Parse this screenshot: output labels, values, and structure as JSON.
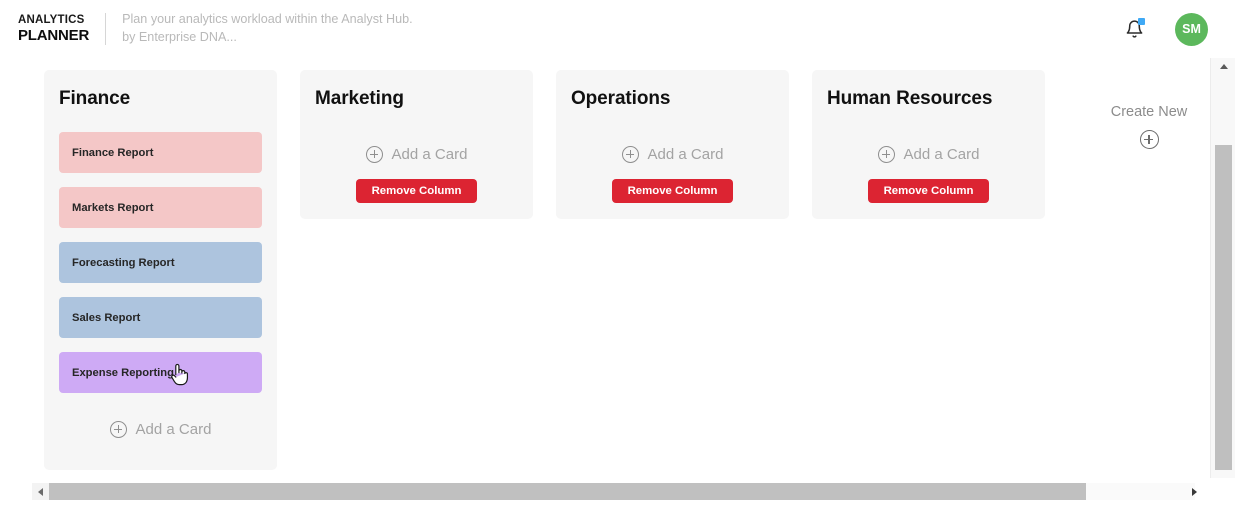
{
  "header": {
    "logo_line1": "ANALYTICS",
    "logo_line2": "PLANNER",
    "tagline_line1": "Plan your analytics workload within the Analyst Hub.",
    "tagline_line2": "by Enterprise DNA...",
    "bell_icon": "bell-icon",
    "notification_badge_color": "#3fa9f5",
    "avatar_initials": "SM",
    "avatar_color": "#5cb85c"
  },
  "board": {
    "add_card_label": "Add a Card",
    "remove_column_label": "Remove Column",
    "columns": [
      {
        "title": "Finance",
        "has_remove_button": false,
        "cards": [
          {
            "label": "Finance Report",
            "color": "#f4c7c7"
          },
          {
            "label": "Markets Report",
            "color": "#f4c7c7"
          },
          {
            "label": "Forecasting Report",
            "color": "#adc4de"
          },
          {
            "label": "Sales Report",
            "color": "#adc4de"
          },
          {
            "label": "Expense Reporting",
            "color": "#ceaaf5"
          }
        ]
      },
      {
        "title": "Marketing",
        "has_remove_button": true,
        "cards": []
      },
      {
        "title": "Operations",
        "has_remove_button": true,
        "cards": []
      },
      {
        "title": "Human Resources",
        "has_remove_button": true,
        "cards": []
      }
    ]
  },
  "create_new": {
    "label": "Create New",
    "icon": "plus-circle-icon"
  },
  "scrollbars": {
    "vertical_up_arrow": "triangle-up-icon",
    "horizontal_left_arrow": "triangle-left-icon",
    "horizontal_right_arrow": "triangle-right-icon"
  },
  "cursor": {
    "type": "pointing-hand-cursor"
  }
}
